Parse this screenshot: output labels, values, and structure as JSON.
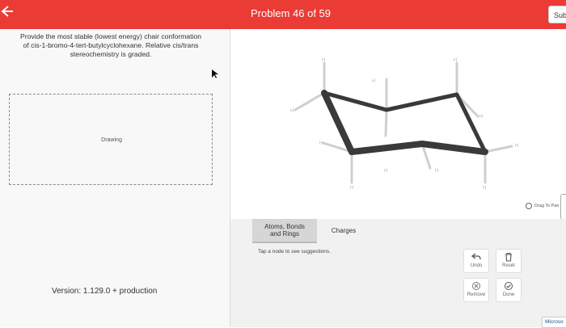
{
  "header": {
    "back_icon": "arrow-left-icon",
    "title": "Problem 46 of 59",
    "submit_label": "Sub"
  },
  "question": {
    "line1": "Provide the most stable (lowest energy) chair conformation",
    "line2": "of cis-1-bromo-4-tert-butylcyclohexane. Relative cis/trans",
    "line3": "stereochemistry is graded."
  },
  "drawing": {
    "label": "Drawing"
  },
  "version": "Version: 1.129.0 + production",
  "canvas": {
    "hydrogen_label": "H",
    "drag_to_pan": "Drag To Pan"
  },
  "toolbar": {
    "tabs": [
      {
        "label_line1": "Atoms, Bonds",
        "label_line2": "and Rings",
        "active": true
      },
      {
        "label": "Charges",
        "active": false
      }
    ],
    "hint": "Tap a node to see suggestions.",
    "actions": {
      "undo": {
        "label": "Undo",
        "icon": "undo-arrow-icon"
      },
      "reset": {
        "label": "Reset",
        "icon": "trash-icon"
      },
      "remove": {
        "label": "Remove",
        "icon": "remove-circle-icon"
      },
      "done": {
        "label": "Done",
        "icon": "check-circle-icon"
      }
    }
  },
  "taskbar": {
    "microsoft_label": "Microso"
  },
  "colors": {
    "header": "#ea3b35",
    "bond_dark": "#3a3a3a",
    "bond_light": "#c9c9c9",
    "panel": "#f1f1f1"
  }
}
